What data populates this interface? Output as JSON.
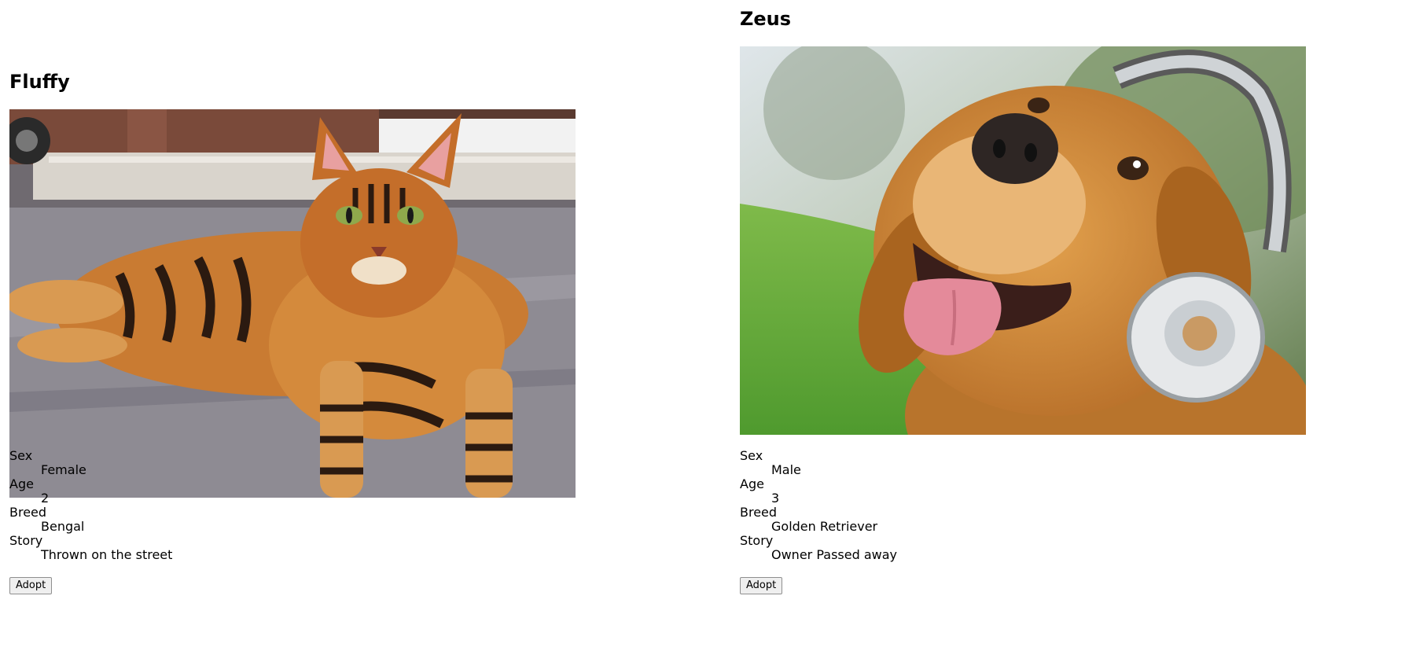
{
  "pets": [
    {
      "name": "Fluffy",
      "details": [
        {
          "label": "Sex",
          "value": "Female"
        },
        {
          "label": "Age",
          "value": "2"
        },
        {
          "label": "Breed",
          "value": "Bengal"
        },
        {
          "label": "Story",
          "value": "Thrown on the street"
        }
      ],
      "adopt_label": "Adopt"
    },
    {
      "name": "Zeus",
      "details": [
        {
          "label": "Sex",
          "value": "Male"
        },
        {
          "label": "Age",
          "value": "3"
        },
        {
          "label": "Breed",
          "value": "Golden Retriever"
        },
        {
          "label": "Story",
          "value": "Owner Passed away"
        }
      ],
      "adopt_label": "Adopt"
    }
  ]
}
